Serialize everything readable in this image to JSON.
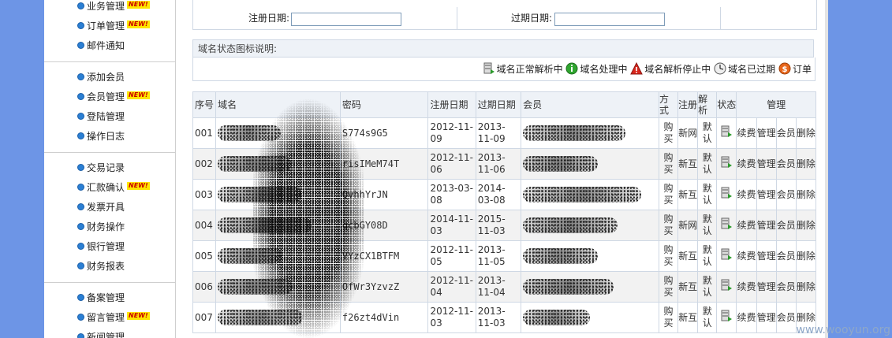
{
  "sidebar": {
    "items": [
      {
        "label": "业务管理",
        "is_new": true
      },
      {
        "label": "订单管理",
        "is_new": true
      },
      {
        "label": "邮件通知",
        "is_new": false
      },
      {
        "label": "添加会员",
        "is_new": false
      },
      {
        "label": "会员管理",
        "is_new": true
      },
      {
        "label": "登陆管理",
        "is_new": false
      },
      {
        "label": "操作日志",
        "is_new": false
      },
      {
        "label": "交易记录",
        "is_new": false
      },
      {
        "label": "汇款确认",
        "is_new": true
      },
      {
        "label": "发票开具",
        "is_new": false
      },
      {
        "label": "财务操作",
        "is_new": false
      },
      {
        "label": "银行管理",
        "is_new": false
      },
      {
        "label": "财务报表",
        "is_new": false
      },
      {
        "label": "备案管理",
        "is_new": false
      },
      {
        "label": "留言管理",
        "is_new": true
      },
      {
        "label": "新闻管理",
        "is_new": false
      }
    ],
    "new_badge": "NEW!"
  },
  "filter": {
    "reg_date_label": "注册日期:",
    "reg_date_value": "",
    "exp_date_label": "过期日期:",
    "exp_date_value": ""
  },
  "legend": {
    "title": "域名状态图标说明:",
    "items": [
      {
        "icon": "server-icon",
        "label": "域名正常解析中"
      },
      {
        "icon": "info-icon",
        "label": "域名处理中"
      },
      {
        "icon": "warning-icon",
        "label": "域名解析停止中"
      },
      {
        "icon": "clock-icon",
        "label": "域名已过期"
      },
      {
        "icon": "dollar-icon",
        "label": "订单"
      }
    ]
  },
  "table": {
    "headers": {
      "index": "序号",
      "domain": "域名",
      "password": "密码",
      "reg_date": "注册日期",
      "exp_date": "过期日期",
      "member": "会员",
      "method": "方式",
      "reg": "注册",
      "dns": "解析",
      "status": "状态",
      "manage": "管理"
    },
    "rows": [
      {
        "index": "001",
        "password": "S774s9G5",
        "reg_date": "2012-11-09",
        "exp_date": "2013-11-09",
        "method": "购买",
        "reg": "新网",
        "dns": "默认"
      },
      {
        "index": "002",
        "password": "risIMeM74T",
        "reg_date": "2012-11-06",
        "exp_date": "2013-11-06",
        "method": "购买",
        "reg": "新互",
        "dns": "默认"
      },
      {
        "index": "003",
        "password": "QvhhYrJN",
        "reg_date": "2013-03-08",
        "exp_date": "2014-03-08",
        "method": "购买",
        "reg": "新互",
        "dns": "默认"
      },
      {
        "index": "004",
        "password": "qcbGY08D",
        "reg_date": "2014-11-03",
        "exp_date": "2015-11-03",
        "method": "购买",
        "reg": "新网",
        "dns": "默认"
      },
      {
        "index": "005",
        "password": "VYzCX1BTFM",
        "reg_date": "2012-11-05",
        "exp_date": "2013-11-05",
        "method": "购买",
        "reg": "新互",
        "dns": "默认"
      },
      {
        "index": "006",
        "password": "OfWr3YzvzZ",
        "reg_date": "2012-11-04",
        "exp_date": "2013-11-04",
        "method": "购买",
        "reg": "新互",
        "dns": "默认"
      },
      {
        "index": "007",
        "password": "f26zt4dVin",
        "reg_date": "2012-11-03",
        "exp_date": "2013-11-03",
        "method": "购买",
        "reg": "新互",
        "dns": "默认"
      }
    ],
    "actions": {
      "renew": "续费",
      "manage": "管理",
      "member": "会员",
      "delete": "删除"
    }
  },
  "watermark": "www.wooyun.org",
  "colors": {
    "page_bg": "#6d95e6",
    "header_bg": "#eef2f7",
    "border": "#cfd8e4",
    "link_bullet": "#2a7fd4"
  }
}
